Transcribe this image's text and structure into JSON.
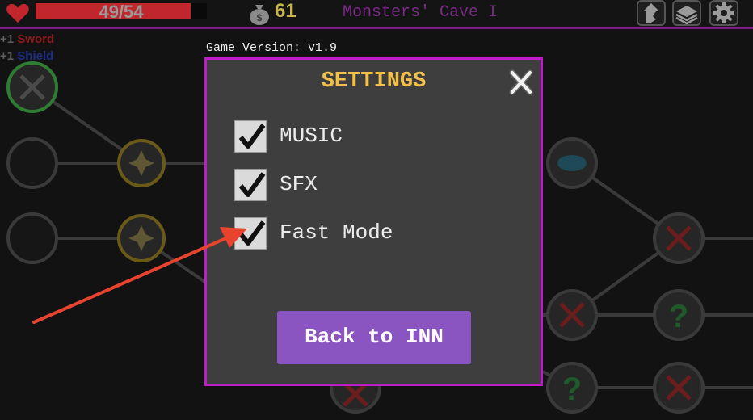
{
  "hud": {
    "hp_text": "49/54",
    "hp_fraction": 0.907,
    "gold": "61",
    "level_title": "Monsters' Cave I",
    "icons": [
      "heart-icon",
      "money-bag-icon",
      "skill-icon",
      "deck-icon",
      "gear-icon"
    ]
  },
  "buffs": [
    {
      "plus": "+1",
      "name": "Sword"
    },
    {
      "plus": "+1",
      "name": "Shield"
    }
  ],
  "version": "Game Version: v1.9",
  "settings": {
    "title": "SETTINGS",
    "options": [
      {
        "label": "MUSIC",
        "checked": true
      },
      {
        "label": "SFX",
        "checked": true
      },
      {
        "label": "Fast Mode",
        "checked": true
      }
    ],
    "back_label": "Back to INN"
  },
  "colors": {
    "accent": "#c21bcc",
    "title": "#f3c14a",
    "button": "#8a55c0",
    "hp": "#c0262c",
    "gold": "#c7b44a",
    "annotation_arrow": "#e8432f"
  }
}
